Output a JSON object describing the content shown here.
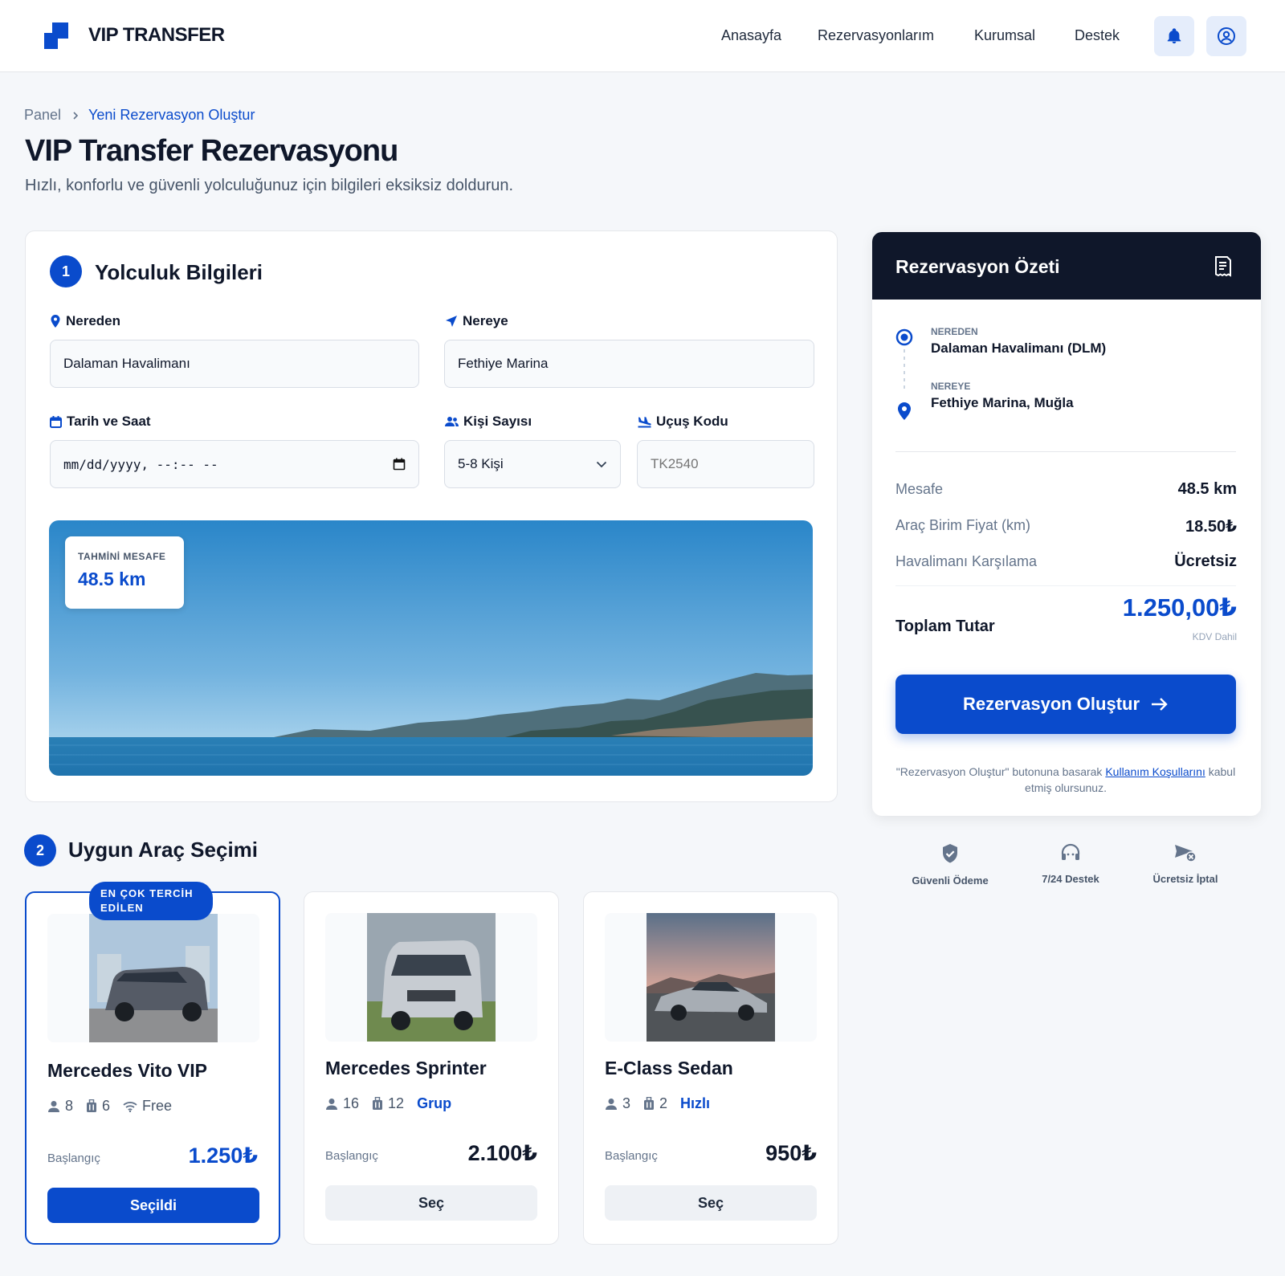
{
  "header": {
    "brand": "VIP TRANSFER",
    "nav": [
      "Anasayfa",
      "Rezervasyonlarım",
      "Kurumsal",
      "Destek"
    ]
  },
  "breadcrumb": {
    "root": "Panel",
    "current": "Yeni Rezervasyon Oluştur"
  },
  "page": {
    "title": "VIP Transfer Rezervasyonu",
    "subtitle": "Hızlı, konforlu ve güvenli yolculuğunuz için bilgileri eksiksiz doldurun."
  },
  "trip": {
    "step": "1",
    "title": "Yolculuk Bilgileri",
    "from_label": "Nereden",
    "from_value": "Dalaman Havalimanı",
    "to_label": "Nereye",
    "to_value": "Fethiye Marina",
    "date_label": "Tarih ve Saat",
    "date_value": "mm/dd/yyyy, --:-- --",
    "pax_label": "Kişi Sayısı",
    "pax_value": "5-8 Kişi",
    "flight_label": "Uçuş Kodu",
    "flight_placeholder": "TK2540",
    "distance_label": "TAHMİNİ MESAFE",
    "distance_value": "48.5 km"
  },
  "vehicles": {
    "step": "2",
    "title": "Uygun Araç Seçimi",
    "ribbon": "EN ÇOK TERCİH EDİLEN",
    "start_label": "Başlangıç",
    "items": [
      {
        "name": "Mercedes Vito VIP",
        "seats": "8",
        "bags": "6",
        "extra": "Free",
        "price": "1.250₺",
        "button": "Seçildi"
      },
      {
        "name": "Mercedes Sprinter",
        "seats": "16",
        "bags": "12",
        "extra": "Grup",
        "price": "2.100₺",
        "button": "Seç"
      },
      {
        "name": "E-Class Sedan",
        "seats": "3",
        "bags": "2",
        "extra": "Hızlı",
        "price": "950₺",
        "button": "Seç"
      }
    ]
  },
  "summary": {
    "title": "Rezervasyon Özeti",
    "from_label": "NEREDEN",
    "from_value": "Dalaman Havalimanı (DLM)",
    "to_label": "NEREYE",
    "to_value": "Fethiye Marina, Muğla",
    "rows": [
      {
        "label": "Mesafe",
        "value": "48.5 km"
      },
      {
        "label": "Araç Birim Fiyat (km)",
        "value": "18.50₺"
      },
      {
        "label": "Havalimanı Karşılama",
        "value": "Ücretsiz"
      }
    ],
    "total_label": "Toplam Tutar",
    "total_value": "1.250,00₺",
    "tax_note": "KDV Dahil",
    "cta": "Rezervasyon Oluştur",
    "terms_prefix": "\"Rezervasyon Oluştur\" butonuna basarak",
    "terms_link": "Kullanım Koşullarını",
    "terms_suffix": "kabul etmiş olursunuz."
  },
  "trust": [
    "Güvenli Ödeme",
    "7/24 Destek",
    "Ücretsiz İptal"
  ],
  "colors": {
    "primary": "#0a4bcc",
    "dark": "#0f172a",
    "background": "#f5f7fa"
  }
}
